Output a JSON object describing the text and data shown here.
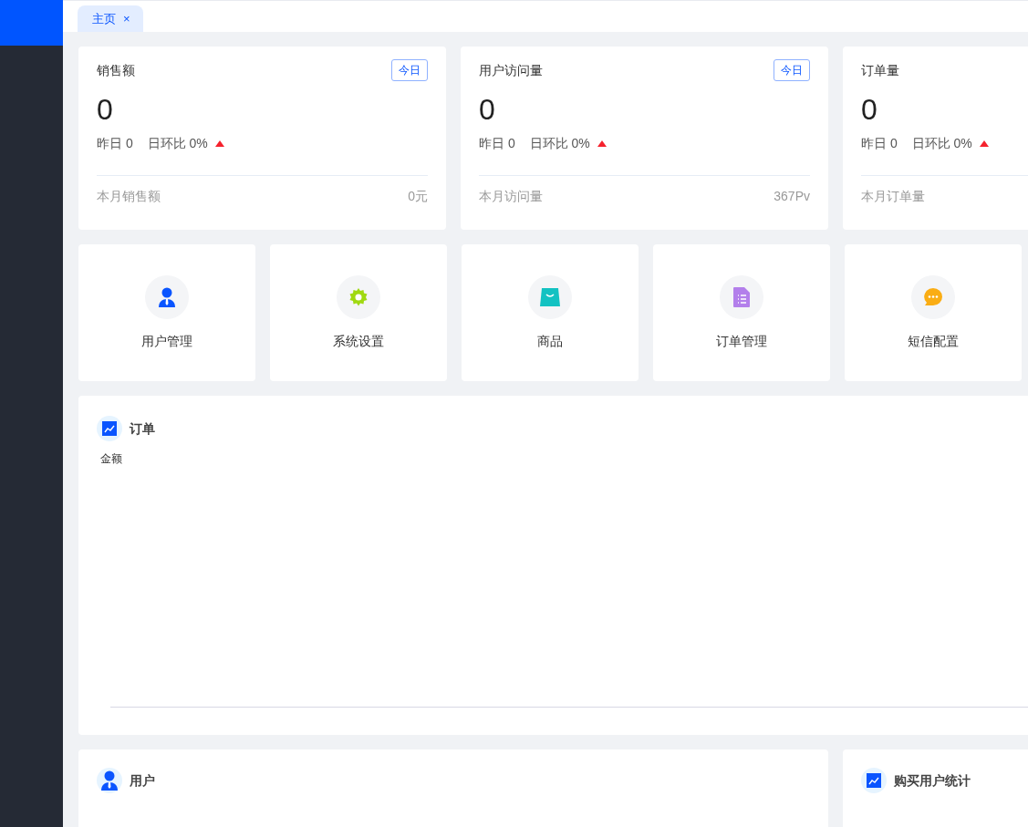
{
  "tabs": [
    {
      "label": "主页",
      "close": "×",
      "selected": true
    }
  ],
  "stats": [
    {
      "title": "销售额",
      "badge": "今日",
      "value": "0",
      "yesterday": "昨日 0",
      "ratio": "日环比 0%",
      "rising": true,
      "footer_label": "本月销售额",
      "footer_value": "0元"
    },
    {
      "title": "用户访问量",
      "badge": "今日",
      "value": "0",
      "yesterday": "昨日 0",
      "ratio": "日环比 0%",
      "rising": true,
      "footer_label": "本月访问量",
      "footer_value": "367Pv"
    },
    {
      "title": "订单量",
      "value": "0",
      "yesterday": "昨日 0",
      "ratio": "日环比 0%",
      "rising": true,
      "footer_label": "本月订单量"
    }
  ],
  "shortcuts": [
    {
      "label": "用户管理",
      "kind": "user",
      "color": "#0a55ff"
    },
    {
      "label": "系统设置",
      "kind": "gear",
      "color": "#a0d911"
    },
    {
      "label": "商品",
      "kind": "bag",
      "color": "#13c2c2"
    },
    {
      "label": "订单管理",
      "kind": "doc",
      "color": "#b37feb"
    },
    {
      "label": "短信配置",
      "kind": "chat",
      "color": "#faad14"
    }
  ],
  "order_panel": {
    "title": "订单",
    "ylabel": "金额"
  },
  "bottom_panels": [
    {
      "title": "用户",
      "kind": "user"
    },
    {
      "title": "购买用户统计",
      "kind": "chart"
    }
  ]
}
